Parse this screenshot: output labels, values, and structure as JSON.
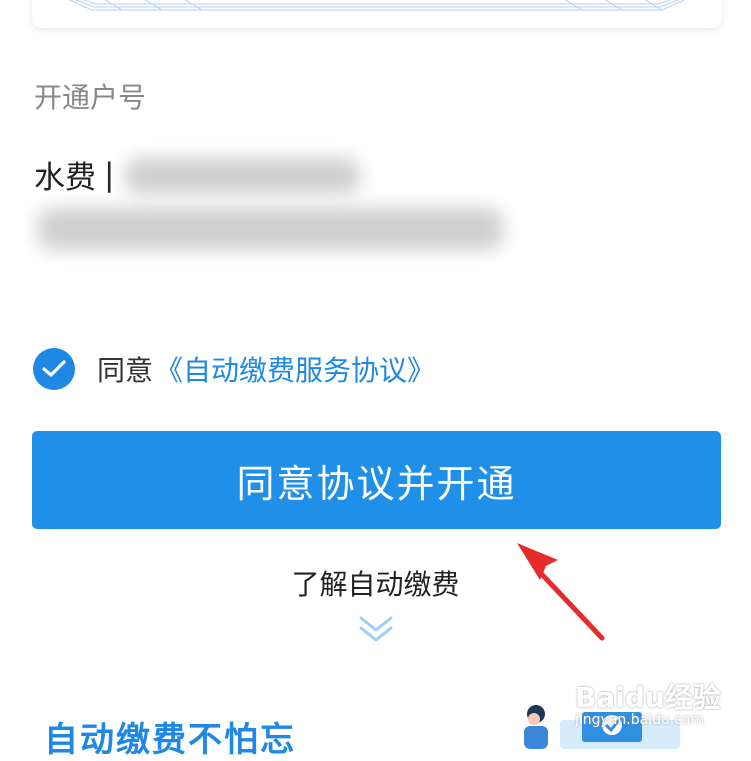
{
  "section": {
    "label": "开通户号"
  },
  "account": {
    "type": "水费",
    "separator": "|"
  },
  "agreement": {
    "prefix": "同意",
    "link_text": "《自动缴费服务协议》",
    "checked": true
  },
  "primary_button": {
    "label": "同意协议并开通"
  },
  "learn_more": {
    "label": "了解自动缴费"
  },
  "promo": {
    "title": "自动缴费不怕忘"
  },
  "watermark": {
    "brand": "Baidu经验",
    "url": "jingyan.baidu.com"
  },
  "colors": {
    "accent": "#1f88e5",
    "button": "#1f8fe8",
    "annotation_arrow": "#e52b2b"
  },
  "icons": {
    "check": "check-icon",
    "chevrons": "double-chevron-down-icon",
    "arrow": "red-pointer-arrow"
  }
}
